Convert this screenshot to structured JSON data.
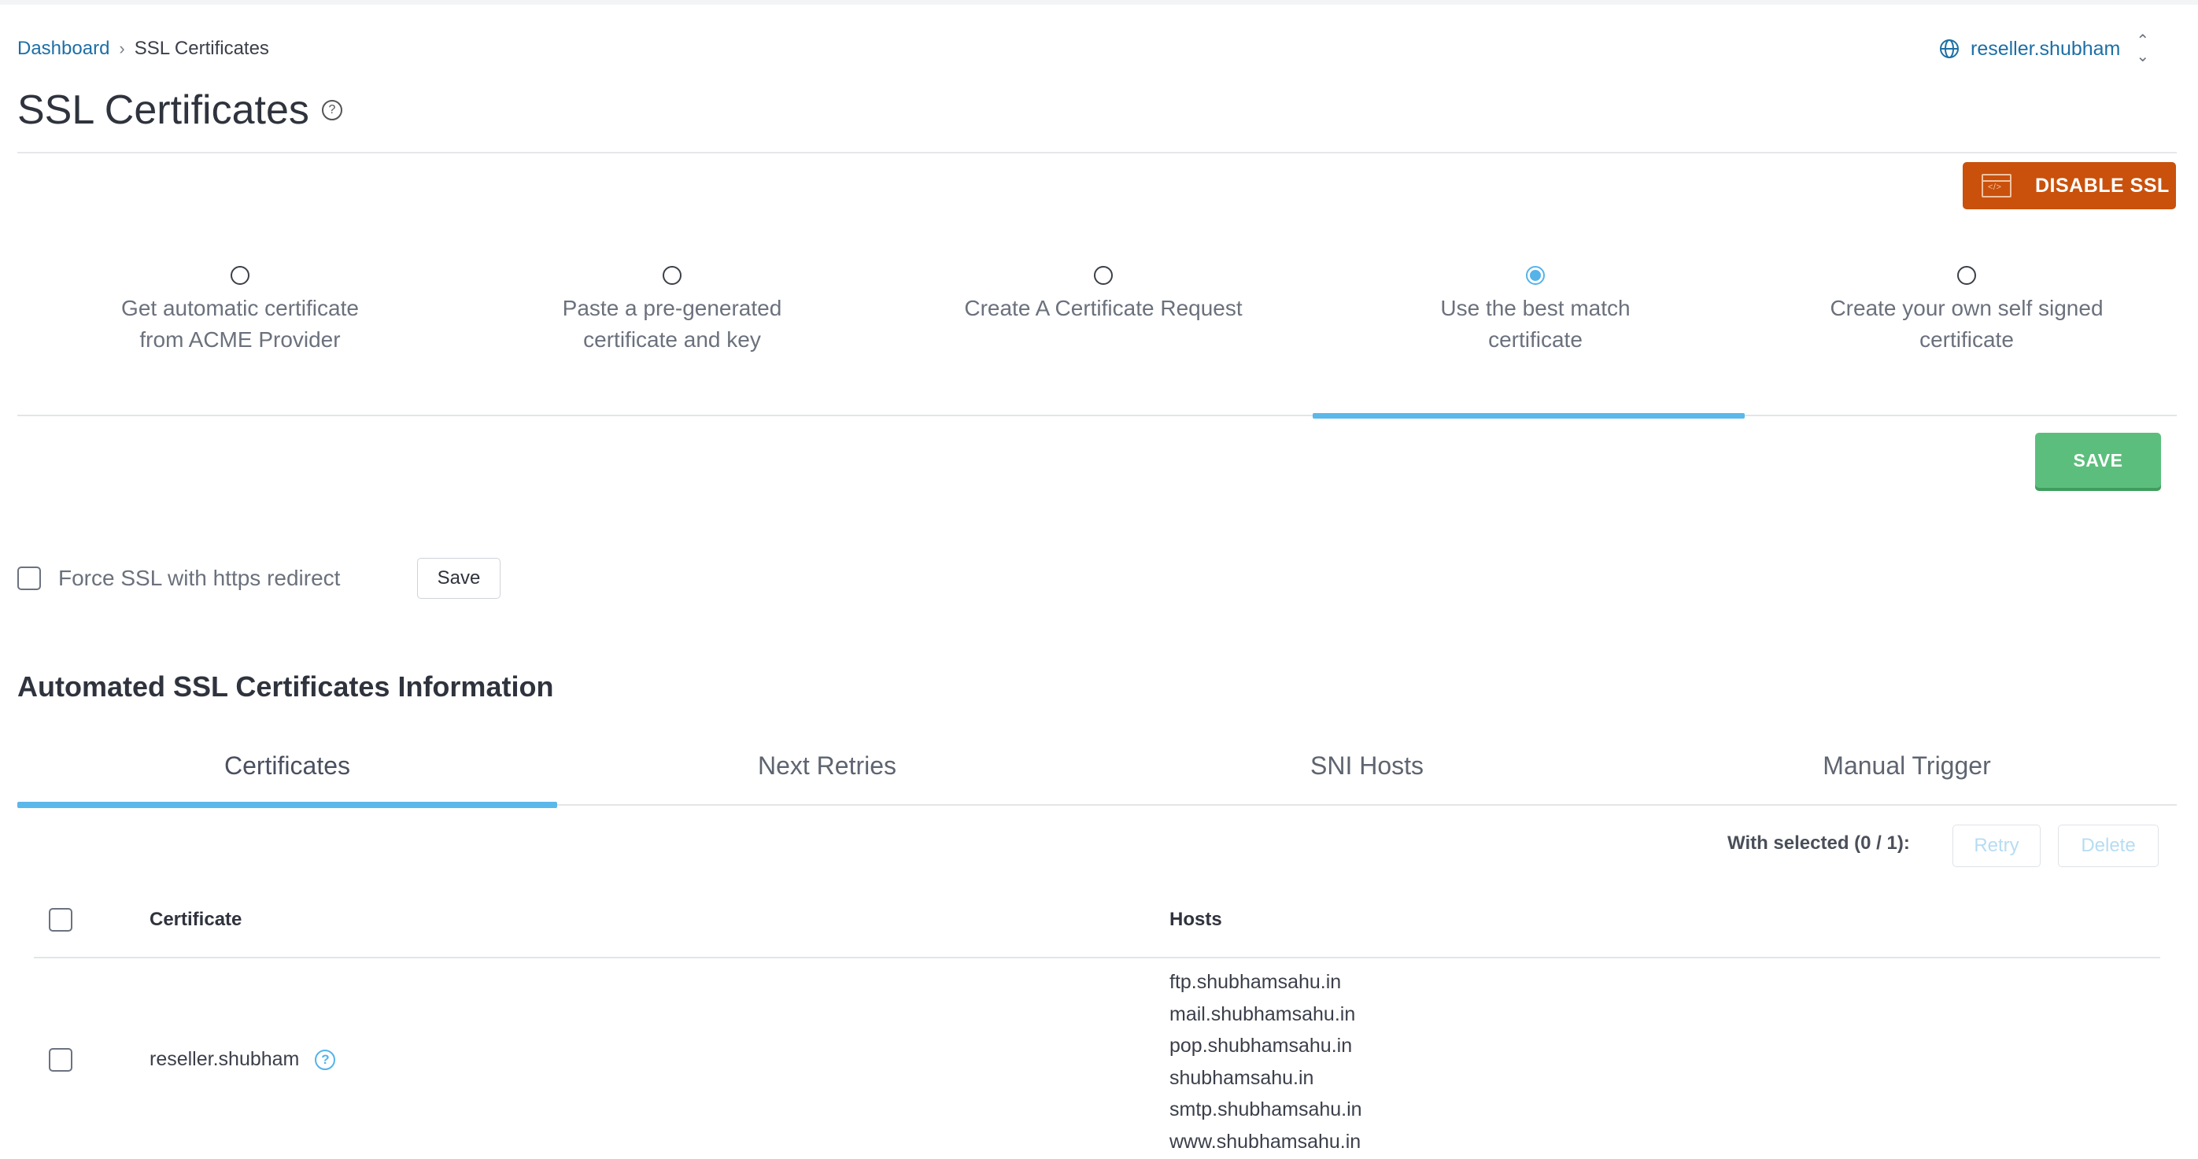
{
  "breadcrumb": {
    "home": "Dashboard",
    "separator": "›",
    "current": "SSL Certificates"
  },
  "account": {
    "name": "reseller.shubham",
    "icon": "globe-icon"
  },
  "page": {
    "title": "SSL Certificates",
    "help_glyph": "?"
  },
  "disable_ssl": {
    "label": "DISABLE SSL",
    "icon": "code-window-icon",
    "color": "#c9510c"
  },
  "options": [
    {
      "line1": "Get automatic certificate",
      "line2": "from ACME Provider",
      "selected": false
    },
    {
      "line1": "Paste a pre-generated",
      "line2": "certificate and key",
      "selected": false
    },
    {
      "line1": "Create A Certificate Request",
      "line2": "",
      "selected": false
    },
    {
      "line1": "Use the best match",
      "line2": "certificate",
      "selected": true
    },
    {
      "line1": "Create your own self signed",
      "line2": "certificate",
      "selected": false
    }
  ],
  "save_main": {
    "label": "SAVE",
    "color": "#5cbe7d"
  },
  "force_ssl": {
    "label": "Force SSL with https redirect",
    "checked": false,
    "save_label": "Save"
  },
  "section": {
    "title": "Automated SSL Certificates Information"
  },
  "tabs": [
    {
      "label": "Certificates",
      "active": true
    },
    {
      "label": "Next Retries",
      "active": false
    },
    {
      "label": "SNI Hosts",
      "active": false
    },
    {
      "label": "Manual Trigger",
      "active": false
    }
  ],
  "bulk": {
    "with_selected": "With selected (0 / 1):",
    "retry": "Retry",
    "delete": "Delete"
  },
  "table": {
    "columns": {
      "certificate": "Certificate",
      "hosts": "Hosts"
    },
    "rows": [
      {
        "certificate": "reseller.shubham",
        "hosts": [
          "ftp.shubhamsahu.in",
          "mail.shubhamsahu.in",
          "pop.shubhamsahu.in",
          "shubhamsahu.in",
          "smtp.shubhamsahu.in",
          "www.shubhamsahu.in"
        ]
      }
    ]
  },
  "accent_color": "#5bb8ea"
}
